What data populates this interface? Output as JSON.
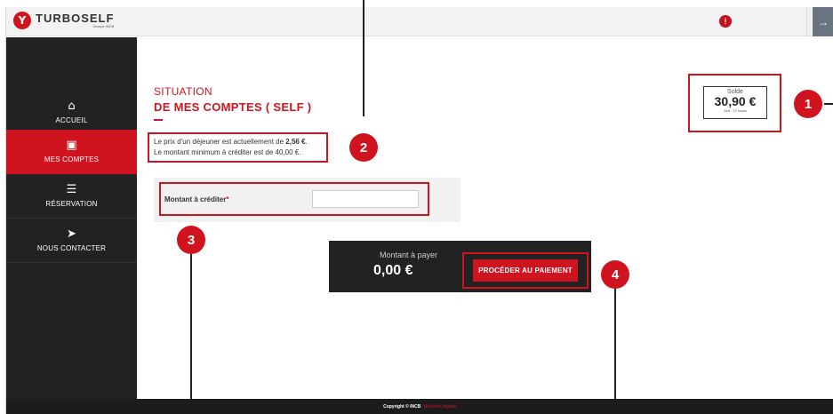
{
  "header": {
    "logo_mark": "Y",
    "logo_name": "TURBOSELF",
    "logo_sub": "Groupe INCB",
    "user_icon_glyph": "!",
    "logout_icon_glyph": "→"
  },
  "sidebar": {
    "items": [
      {
        "label": "ACCUEIL",
        "icon": "home-icon",
        "glyph": "⌂",
        "active": false
      },
      {
        "label": "MES COMPTES",
        "icon": "wallet-icon",
        "glyph": "▣",
        "active": true
      },
      {
        "label": "RÉSERVATION",
        "icon": "calendar-icon",
        "glyph": "☰",
        "active": false
      },
      {
        "label": "NOUS CONTACTER",
        "icon": "send-icon",
        "glyph": "➤",
        "active": false
      }
    ]
  },
  "page": {
    "title_light": "SITUATION",
    "title_bold": "DE MES COMPTES ( SELF )",
    "info_line1_prefix": "Le prix d'un déjeuner est actuellement de ",
    "info_line1_price": "2,56 €",
    "info_line1_suffix": ".",
    "info_line2": "Le montant minimum à  créditer est de 40,00 €."
  },
  "form": {
    "label": "Montant à créditer",
    "required_mark": "*",
    "value": "",
    "placeholder": ""
  },
  "payment": {
    "label": "Montant à payer",
    "amount": "0,00 €",
    "button_label": "PROCÉDER AU PAIEMENT"
  },
  "balance": {
    "label": "Solde",
    "amount": "30,90 €",
    "sub": "Soit : 12 repas"
  },
  "callouts": [
    "1",
    "2",
    "3",
    "4"
  ],
  "footer": {
    "copyright": "Copyright © INCB",
    "legal_link": "Mentions légales"
  },
  "colors": {
    "brand_red": "#d0141f",
    "sidebar_dark": "#222222",
    "header_bg": "#f2f2f2"
  }
}
